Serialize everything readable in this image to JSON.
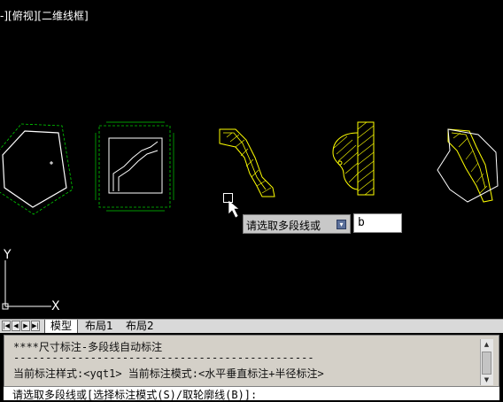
{
  "viewport": {
    "view_label": "-][俯视][二维线框]",
    "axis_y": "Y",
    "axis_x": "X"
  },
  "prompt": {
    "tooltip_text": "请选取多段线或",
    "input_value": "b"
  },
  "tabs": {
    "items": [
      "模型",
      "布局1",
      "布局2"
    ],
    "active": "模型"
  },
  "command": {
    "line1": "****尺寸标注-多段线自动标注",
    "line2": "-----------------------------------------------",
    "line3": "当前标注样式:<yqt1>  当前标注模式:<水平垂直标注+半径标注>",
    "input_line": "请选取多段线或[选择标注模式(S)/取轮廓线(B)]:"
  },
  "colors": {
    "background": "#000000",
    "dimension": "#00cc00",
    "outline": "#ffff00",
    "hatch": "#ffff00"
  },
  "icons": {
    "ucs": "ucs-axis-icon",
    "cursor": "pickbox-cursor-icon",
    "dropdown": "dropdown-arrow-icon",
    "nav": [
      "first-icon",
      "prev-icon",
      "next-icon",
      "last-icon"
    ]
  }
}
